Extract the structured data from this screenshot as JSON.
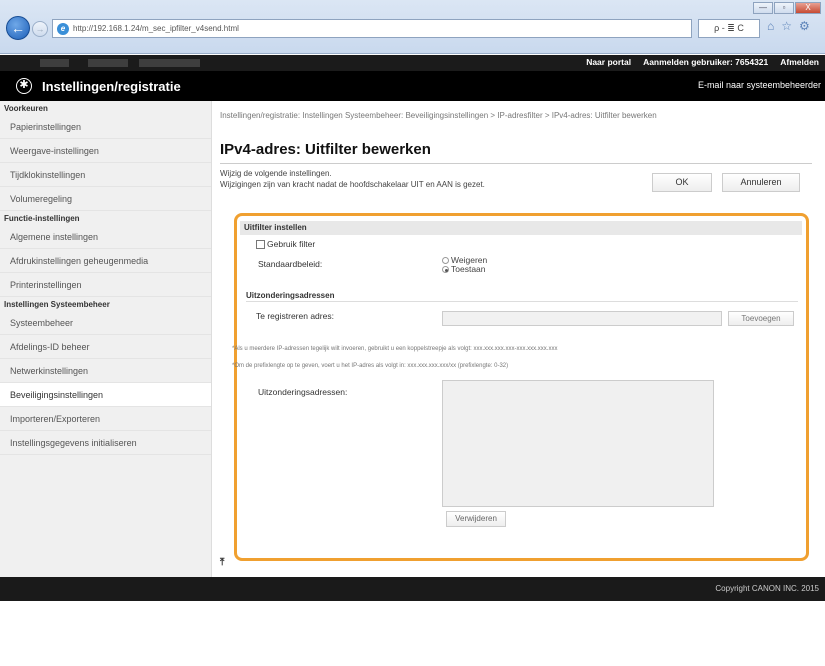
{
  "browser": {
    "window_controls": [
      "—",
      "▫",
      "X"
    ],
    "url": "http://192.168.1.24/m_sec_ipfilter_v4send.html",
    "url_tools": "ρ - ≣ C",
    "icons": [
      "⌂",
      "☆",
      "⚙"
    ]
  },
  "app": {
    "top_links": [
      "Naar portal",
      "Aanmelden gebruiker: 7654321",
      "Afmelden"
    ],
    "title": "Instellingen/registratie",
    "mail_admin": "E-mail naar systeembeheerder"
  },
  "sidebar": {
    "sections": [
      {
        "title": "Voorkeuren",
        "items": [
          "Papierinstellingen",
          "Weergave-instellingen",
          "Tijdklokinstellingen",
          "Volumeregeling"
        ]
      },
      {
        "title": "Functie-instellingen",
        "items": [
          "Algemene instellingen",
          "Afdrukinstellingen geheugenmedia",
          "Printerinstellingen"
        ]
      },
      {
        "title": "Instellingen Systeembeheer",
        "items": [
          "Systeembeheer",
          "Afdelings-ID beheer",
          "Netwerkinstellingen",
          "Beveiligingsinstellingen",
          "Importeren/Exporteren",
          "Instellingsgegevens initialiseren"
        ]
      }
    ],
    "active": "Beveiligingsinstellingen"
  },
  "main": {
    "breadcrumb": "Instellingen/registratie: Instellingen Systeembeheer: Beveiligingsinstellingen > IP-adresfilter > IPv4-adres: Uitfilter bewerken",
    "page_title": "IPv4-adres: Uitfilter bewerken",
    "intro_line1": "Wijzig de volgende instellingen.",
    "intro_line2": "Wijzigingen zijn van kracht nadat de hoofdschakelaar UIT en AAN is gezet.",
    "ok_label": "OK",
    "cancel_label": "Annuleren",
    "filter_header": "Uitfilter instellen",
    "use_filter_label": "Gebruik filter",
    "use_filter_checked": false,
    "policy_label": "Standaardbeleid:",
    "policy_options": [
      "Weigeren",
      "Toestaan"
    ],
    "policy_selected": "Toestaan",
    "exceptions_subheader": "Uitzonderingsadressen",
    "register_label": "Te registreren adres:",
    "register_value": "",
    "add_label": "Toevoegen",
    "note_1": "*Als u meerdere IP-adressen tegelijk wilt invoeren, gebruikt u een koppelstreepje als volgt: xxx.xxx.xxx.xxx-xxx.xxx.xxx.xxx",
    "note_2": "*Om de prefixlengte op te geven, voert u het IP-adres als volgt in: xxx.xxx.xxx.xxx/xx (prefixlengte: 0-32)",
    "exceptions_list_label": "Uitzonderingsadressen:",
    "delete_label": "Verwijderen",
    "top_anchor": "⤒"
  },
  "footer": {
    "copyright": "Copyright CANON INC. 2015"
  },
  "colors": {
    "highlight_frame": "#f0a030",
    "header_bg": "#000000",
    "sidebar_bg": "#f0f0f0"
  }
}
